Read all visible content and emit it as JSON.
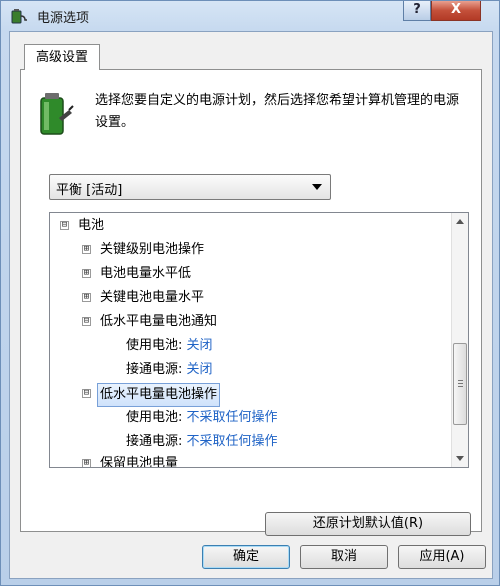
{
  "window": {
    "title": "电源选项",
    "help_label": "?",
    "close_label": "X"
  },
  "tabs": [
    {
      "label": "高级设置"
    }
  ],
  "description": "选择您要自定义的电源计划，然后选择您希望计算机管理的电源设置。",
  "plan_select": {
    "value": "平衡 [活动]"
  },
  "tree": [
    {
      "label": "电池",
      "expander": "⊟"
    },
    {
      "label": "关键级别电池操作",
      "expander": "⊞"
    },
    {
      "label": "电池电量水平低",
      "expander": "⊞"
    },
    {
      "label": "关键电池电量水平",
      "expander": "⊞"
    },
    {
      "label": "低水平电量电池通知",
      "expander": "⊟"
    },
    {
      "label": "使用电池:",
      "value": "关闭"
    },
    {
      "label": "接通电源:",
      "value": "关闭"
    },
    {
      "label": "低水平电量电池操作",
      "expander": "⊟",
      "selected": true
    },
    {
      "label": "使用电池:",
      "value": "不采取任何操作"
    },
    {
      "label": "接通电源:",
      "value": "不采取任何操作"
    },
    {
      "label": "保留电池电量",
      "expander": "⊞"
    }
  ],
  "buttons": {
    "restore": "还原计划默认值(R)",
    "ok": "确定",
    "cancel": "取消",
    "apply": "应用(A)"
  },
  "colors": {
    "value_text": "#1f63c6",
    "selection_bg": "#cfe2fb",
    "close_button": "#c4503a"
  }
}
